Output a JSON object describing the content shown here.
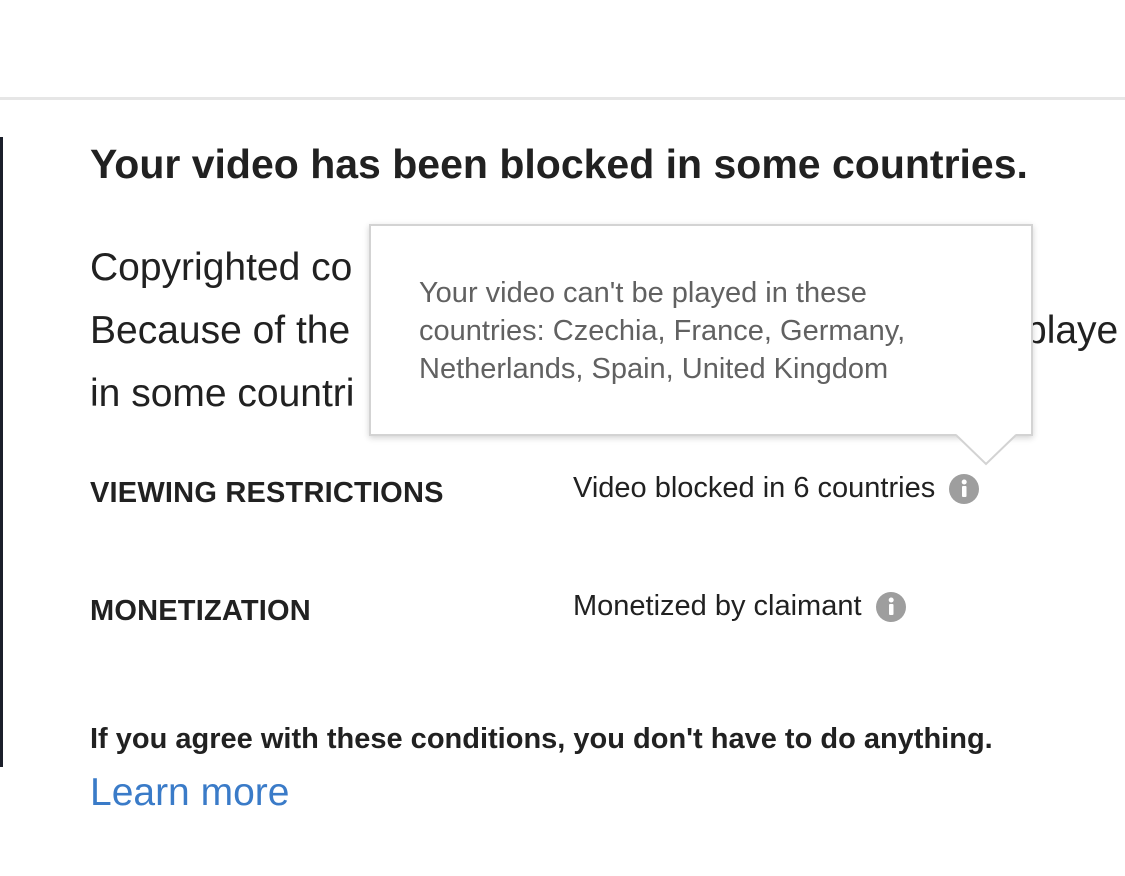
{
  "notice": {
    "title": "Your video has been blocked in some countries.",
    "body_lines": [
      "Copyrighted co",
      "Because of the",
      "in some countri"
    ],
    "body_line_2_tail": "playe"
  },
  "restrictions": {
    "viewing": {
      "label": "VIEWING RESTRICTIONS",
      "value": "Video blocked in 6 countries",
      "icon": "info-icon"
    },
    "monetization": {
      "label": "MONETIZATION",
      "value": "Monetized by claimant",
      "icon": "info-icon"
    }
  },
  "tooltip": {
    "text": "Your video can't be played in these countries: Czechia, France, Germany, Netherlands, Spain, United Kingdom"
  },
  "footer": {
    "agree_text": "If you agree with these conditions, you don't have to do anything.",
    "learn_more": "Learn more"
  },
  "colors": {
    "link": "#3a7bc8",
    "text": "#212121",
    "tooltip_text": "#616161",
    "icon": "#9e9e9e"
  }
}
